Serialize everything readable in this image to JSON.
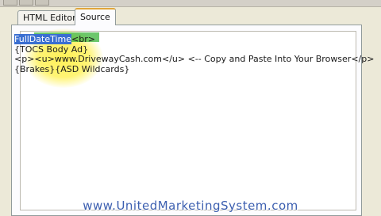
{
  "tabs": [
    {
      "label": "HTML Editor",
      "active": false
    },
    {
      "label": "Source",
      "active": true
    }
  ],
  "editor": {
    "line1_selected": "FullDateTime",
    "line1_rest": "<br>",
    "line2": "{TOCS Body Ad}",
    "line3": "<p><u>www.DrivewayCash.com</u> <-- Copy and Paste Into Your Browser</p>",
    "line4": "{Brakes}{ASD Wildcards}"
  },
  "footer": {
    "watermark": "www.UnitedMarketingSystem.com"
  },
  "colors": {
    "selection": "#3a6fd1",
    "highlight": "#fff046",
    "watermark": "#3c5fb0"
  }
}
